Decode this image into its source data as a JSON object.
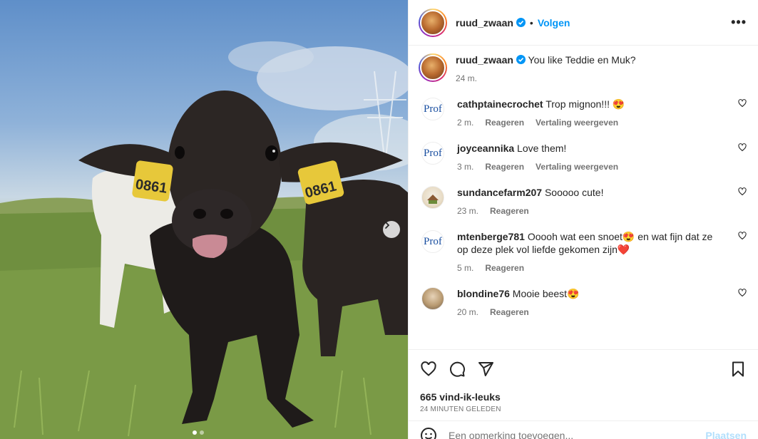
{
  "post": {
    "username": "ruud_zwaan",
    "follow_label": "Volgen",
    "more_label": "•••"
  },
  "caption": {
    "username": "ruud_zwaan",
    "text": "You like Teddie en Muk?",
    "time": "24 m."
  },
  "comments": [
    {
      "username": "cathptainecrochet",
      "text": "Trop mignon!!! 😍",
      "time": "2 m.",
      "reply": "Reageren",
      "translate": "Vertaling weergeven",
      "avatar_text": "Prof"
    },
    {
      "username": "joyceannika",
      "text": "Love them!",
      "time": "3 m.",
      "reply": "Reageren",
      "translate": "Vertaling weergeven",
      "avatar_text": "Prof"
    },
    {
      "username": "sundancefarm207",
      "text": "Sooooo cute!",
      "time": "23 m.",
      "reply": "Reageren"
    },
    {
      "username": "mtenberge781",
      "text": "Ooooh wat een snoet😍 en wat fijn dat ze op deze plek vol liefde gekomen zijn❤️",
      "time": "5 m.",
      "reply": "Reageren",
      "avatar_text": "Prof"
    },
    {
      "username": "blondine76",
      "text": "Mooie beest😍",
      "time": "20 m.",
      "reply": "Reageren"
    }
  ],
  "likes": "665 vind-ik-leuks",
  "posted_when": "24 minuten geleden",
  "add_comment": {
    "placeholder": "Een opmerking toevoegen...",
    "post_label": "Plaatsen"
  },
  "photo": {
    "ear_tag_left": "0861",
    "ear_tag_right": "0861",
    "tag_small": "NL 6379"
  },
  "colors": {
    "accent": "#0095f6",
    "text": "#262626",
    "muted": "#737373"
  },
  "icons": [
    "verified-icon",
    "more-icon",
    "heart-icon",
    "comment-icon",
    "share-icon",
    "bookmark-icon",
    "emoji-icon",
    "chevron-right-icon"
  ]
}
